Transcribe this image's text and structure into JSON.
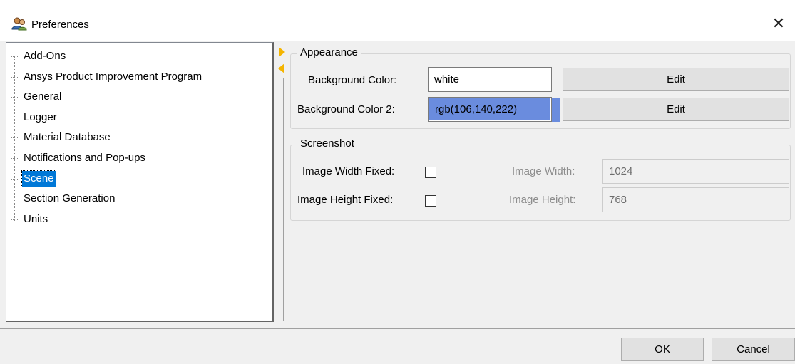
{
  "window": {
    "title": "Preferences",
    "close_glyph": "✕",
    "icon": "users-icon"
  },
  "tree": {
    "items": [
      {
        "label": "Add-Ons"
      },
      {
        "label": "Ansys Product Improvement Program"
      },
      {
        "label": "General"
      },
      {
        "label": "Logger"
      },
      {
        "label": "Material Database"
      },
      {
        "label": "Notifications and Pop-ups"
      },
      {
        "label": "Scene",
        "selected": true
      },
      {
        "label": "Section Generation"
      },
      {
        "label": "Units"
      }
    ]
  },
  "appearance": {
    "legend": "Appearance",
    "bg_color_label": "Background Color:",
    "bg_color_value": "white",
    "bg_color2_label": "Background Color 2:",
    "bg_color2_value": "rgb(106,140,222)",
    "bg_color2_swatch": "#6a8cde",
    "edit_label": "Edit"
  },
  "screenshot": {
    "legend": "Screenshot",
    "width_fixed_label": "Image Width Fixed:",
    "height_fixed_label": "Image Height Fixed:",
    "width_label": "Image Width:",
    "width_value": "1024",
    "height_label": "Image Height:",
    "height_value": "768"
  },
  "footer": {
    "ok_label": "OK",
    "cancel_label": "Cancel"
  }
}
